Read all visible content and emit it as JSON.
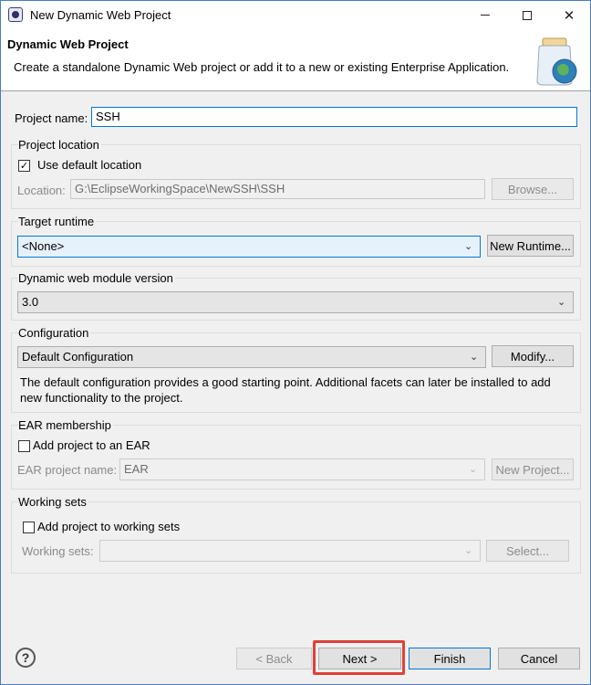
{
  "window": {
    "title": "New Dynamic Web Project"
  },
  "banner": {
    "title": "Dynamic Web Project",
    "description": "Create a standalone Dynamic Web project or add it to a new or existing Enterprise Application."
  },
  "project_name": {
    "label": "Project name:",
    "value": "SSH"
  },
  "project_location": {
    "group_title": "Project location",
    "use_default_label": "Use default location",
    "use_default_checked": true,
    "location_label": "Location:",
    "location_value": "G:\\EclipseWorkingSpace\\NewSSH\\SSH",
    "browse_label": "Browse..."
  },
  "target_runtime": {
    "group_title": "Target runtime",
    "selected": "<None>",
    "new_runtime_label": "New Runtime..."
  },
  "module_version": {
    "group_title": "Dynamic web module version",
    "selected": "3.0"
  },
  "configuration": {
    "group_title": "Configuration",
    "selected": "Default Configuration",
    "modify_label": "Modify...",
    "description_line1": "The default configuration provides a good starting point. Additional facets can later be installed to add",
    "description_line2": "new functionality to the project."
  },
  "ear_membership": {
    "group_title": "EAR membership",
    "add_label": "Add project to an EAR",
    "add_checked": false,
    "project_name_label": "EAR project name:",
    "project_name_value": "EAR",
    "new_project_label": "New Project..."
  },
  "working_sets": {
    "group_title": "Working sets",
    "add_label": "Add project to working sets",
    "add_checked": false,
    "sets_label": "Working sets:",
    "select_label": "Select..."
  },
  "footer": {
    "help_glyph": "?",
    "back_label": "< Back",
    "next_label": "Next >",
    "finish_label": "Finish",
    "cancel_label": "Cancel"
  },
  "icons": {
    "check_glyph": "✓",
    "dropdown_glyph": "⌄",
    "close_glyph": "✕"
  }
}
